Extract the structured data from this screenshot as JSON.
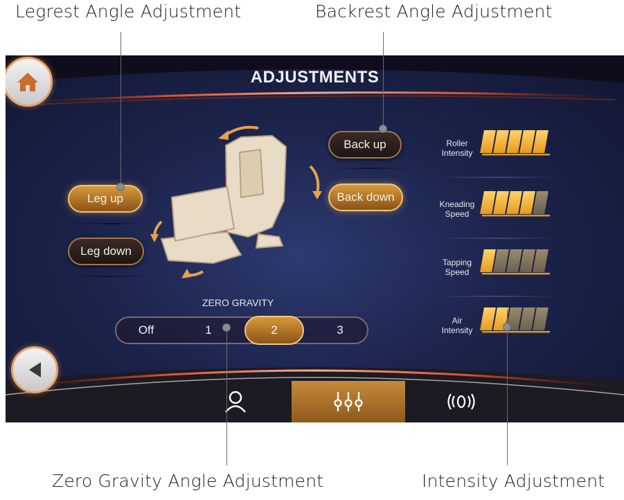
{
  "callouts": {
    "legrest": "Legrest Angle Adjustment",
    "backrest": "Backrest Angle Adjustment",
    "zero_gravity": "Zero Gravity Angle Adjustment",
    "intensity": "Intensity Adjustment"
  },
  "screen": {
    "title": "ADJUSTMENTS",
    "buttons": {
      "leg_up": "Leg up",
      "leg_down": "Leg down",
      "back_up": "Back up",
      "back_down": "Back down"
    },
    "zero_gravity": {
      "label": "ZERO GRAVITY",
      "options": [
        "Off",
        "1",
        "2",
        "3"
      ],
      "selected": "2"
    },
    "intensity": [
      {
        "line1": "Roller",
        "line2": "Intensity",
        "level": 5,
        "max": 5
      },
      {
        "line1": "Kneading",
        "line2": "Speed",
        "level": 4,
        "max": 5
      },
      {
        "line1": "Tapping",
        "line2": "Speed",
        "level": 1,
        "max": 5
      },
      {
        "line1": "Air",
        "line2": "Intensity",
        "level": 2,
        "max": 5
      }
    ],
    "nav": [
      {
        "icon": "person-icon",
        "active": false
      },
      {
        "icon": "sliders-icon",
        "active": true
      },
      {
        "icon": "vibration-icon",
        "active": false
      }
    ],
    "colors": {
      "accent_gold": "#d79a3c",
      "background": "#1c244c",
      "bar_on": "#ffd36a",
      "bar_off": "#8a7b60"
    }
  }
}
